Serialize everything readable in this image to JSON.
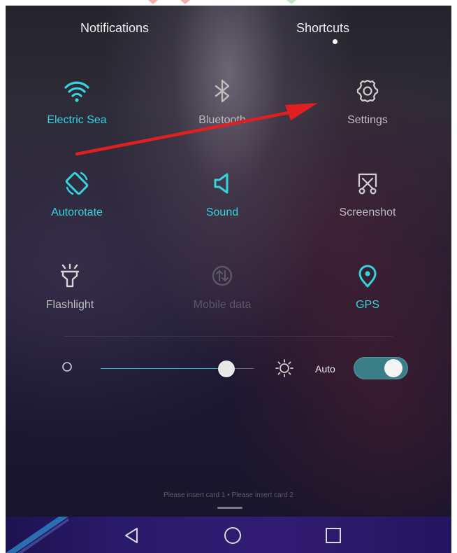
{
  "tabs": [
    {
      "label": "Notifications",
      "active": false
    },
    {
      "label": "Shortcuts",
      "active": true
    }
  ],
  "tiles": [
    {
      "label": "Electric Sea",
      "icon": "wifi-icon",
      "state": "on"
    },
    {
      "label": "Bluetooth",
      "icon": "bluetooth-icon",
      "state": "off"
    },
    {
      "label": "Settings",
      "icon": "gear-icon",
      "state": "off"
    },
    {
      "label": "Autorotate",
      "icon": "rotate-icon",
      "state": "on"
    },
    {
      "label": "Sound",
      "icon": "speaker-icon",
      "state": "on"
    },
    {
      "label": "Screenshot",
      "icon": "screenshot-icon",
      "state": "off"
    },
    {
      "label": "Flashlight",
      "icon": "flashlight-icon",
      "state": "off"
    },
    {
      "label": "Mobile data",
      "icon": "mobile-data-icon",
      "state": "disabled"
    },
    {
      "label": "GPS",
      "icon": "location-pin-icon",
      "state": "on"
    }
  ],
  "brightness": {
    "level": 0.82,
    "auto_label": "Auto",
    "auto_enabled": true
  },
  "sim_status": "Please insert card 1 • Please insert card 2",
  "colors": {
    "accent": "#33d4dc",
    "annotation_arrow": "#e02020",
    "navbar": "#2a1a6a"
  }
}
